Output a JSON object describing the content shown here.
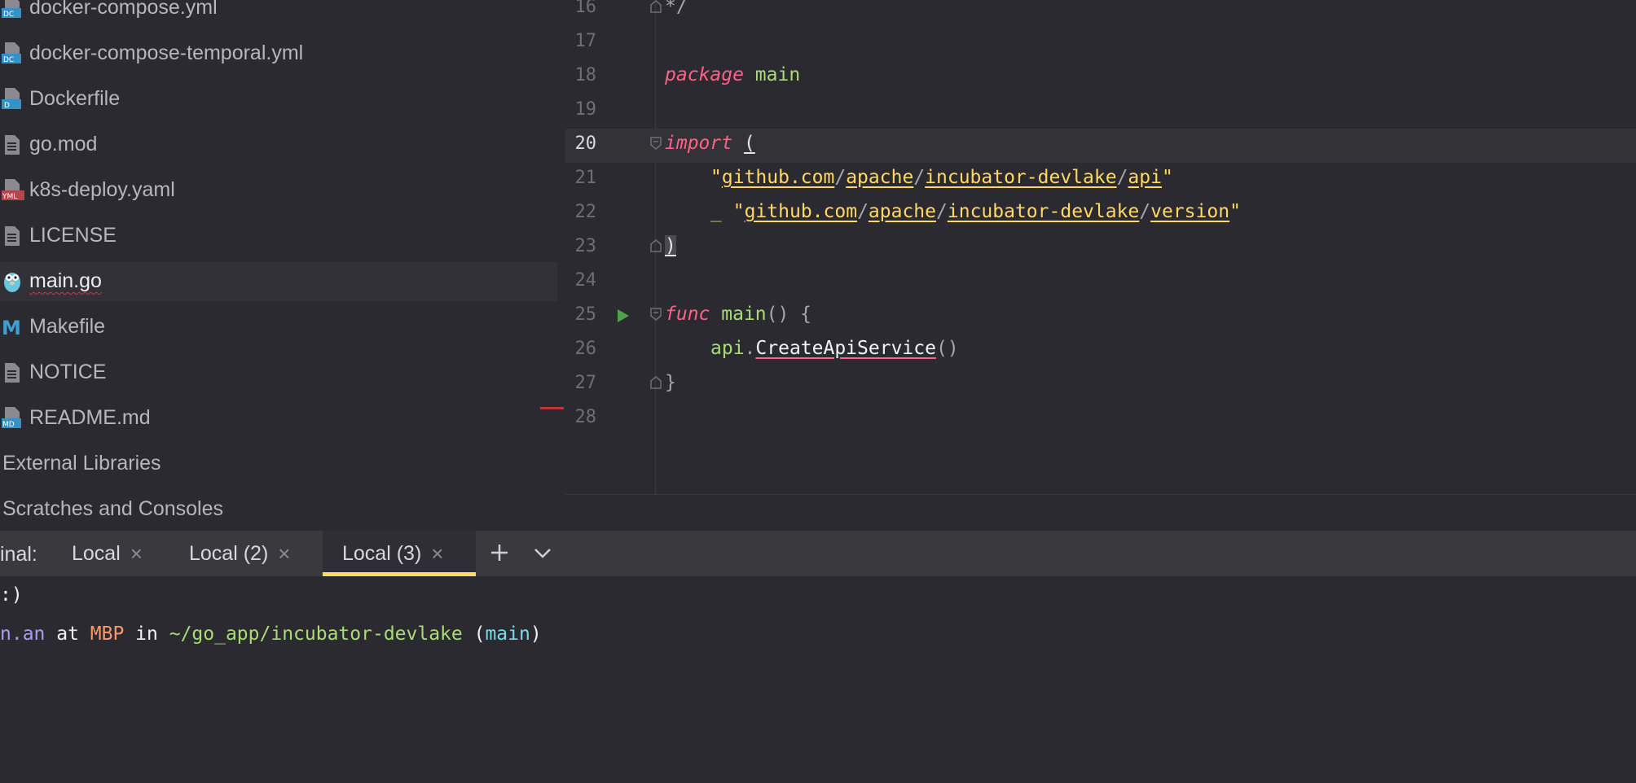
{
  "project_tree": {
    "files": [
      {
        "name": "docker-compose.yml",
        "icon": "docker-compose-file-icon",
        "icon_text": "DC"
      },
      {
        "name": "docker-compose-temporal.yml",
        "icon": "docker-compose-file-icon",
        "icon_text": "DC"
      },
      {
        "name": "Dockerfile",
        "icon": "dockerfile-icon",
        "icon_text": "D"
      },
      {
        "name": "go.mod",
        "icon": "text-file-icon",
        "icon_text": ""
      },
      {
        "name": "k8s-deploy.yaml",
        "icon": "yaml-file-icon",
        "icon_text": "YML"
      },
      {
        "name": "LICENSE",
        "icon": "text-file-icon",
        "icon_text": ""
      },
      {
        "name": "main.go",
        "icon": "go-gopher-icon",
        "icon_text": ""
      },
      {
        "name": "Makefile",
        "icon": "makefile-icon",
        "icon_text": "M"
      },
      {
        "name": "NOTICE",
        "icon": "text-file-icon",
        "icon_text": ""
      },
      {
        "name": "README.md",
        "icon": "markdown-file-icon",
        "icon_text": "MD"
      }
    ],
    "groups": [
      "External Libraries",
      "Scratches and Consoles"
    ],
    "selected": "main.go"
  },
  "editor": {
    "current_line": "20",
    "lines": [
      {
        "num": "16",
        "text": "*/"
      },
      {
        "num": "17",
        "text": ""
      },
      {
        "num": "18",
        "kw": "package",
        "name": "main"
      },
      {
        "num": "19",
        "text": ""
      },
      {
        "num": "20",
        "kw": "import",
        "open": "("
      },
      {
        "num": "21",
        "q1": "\"",
        "p1": "github.com",
        "s1": "/",
        "p2": "apache",
        "s2": "/",
        "p3": "incubator-devlake",
        "s3": "/",
        "p4": "api",
        "q2": "\""
      },
      {
        "num": "22",
        "blank": "_",
        "q1": "\"",
        "p1": "github.com",
        "s1": "/",
        "p2": "apache",
        "s2": "/",
        "p3": "incubator-devlake",
        "s3": "/",
        "p4": "version",
        "q2": "\""
      },
      {
        "num": "23",
        "close": ")"
      },
      {
        "num": "24",
        "text": ""
      },
      {
        "num": "25",
        "kw": "func",
        "name": "main",
        "rest": "() {"
      },
      {
        "num": "26",
        "pkg": "api",
        "dot": ".",
        "call": "CreateApiService",
        "parens": "()"
      },
      {
        "num": "27",
        "text": "}"
      },
      {
        "num": "28",
        "text": ""
      }
    ]
  },
  "terminal": {
    "label": "inal:",
    "tabs": [
      {
        "label": "Local",
        "close": "×"
      },
      {
        "label": "Local (2)",
        "close": "×"
      },
      {
        "label": "Local (3)",
        "close": "×"
      }
    ],
    "active_tab": "Local (3)",
    "output": [
      {
        "text": ":)"
      },
      {
        "user": "n.an",
        "at": " at ",
        "host": "MBP",
        "in": " in ",
        "path": "~/go_app/incubator-devlake",
        "open": " (",
        "branch": "main",
        "close": ")"
      }
    ]
  },
  "colors": {
    "keyword": "#ff6188",
    "function": "#a9dc76",
    "string": "#ffd866",
    "active_tab_underline": "#ffd866",
    "error_marker": "#c3343a"
  }
}
